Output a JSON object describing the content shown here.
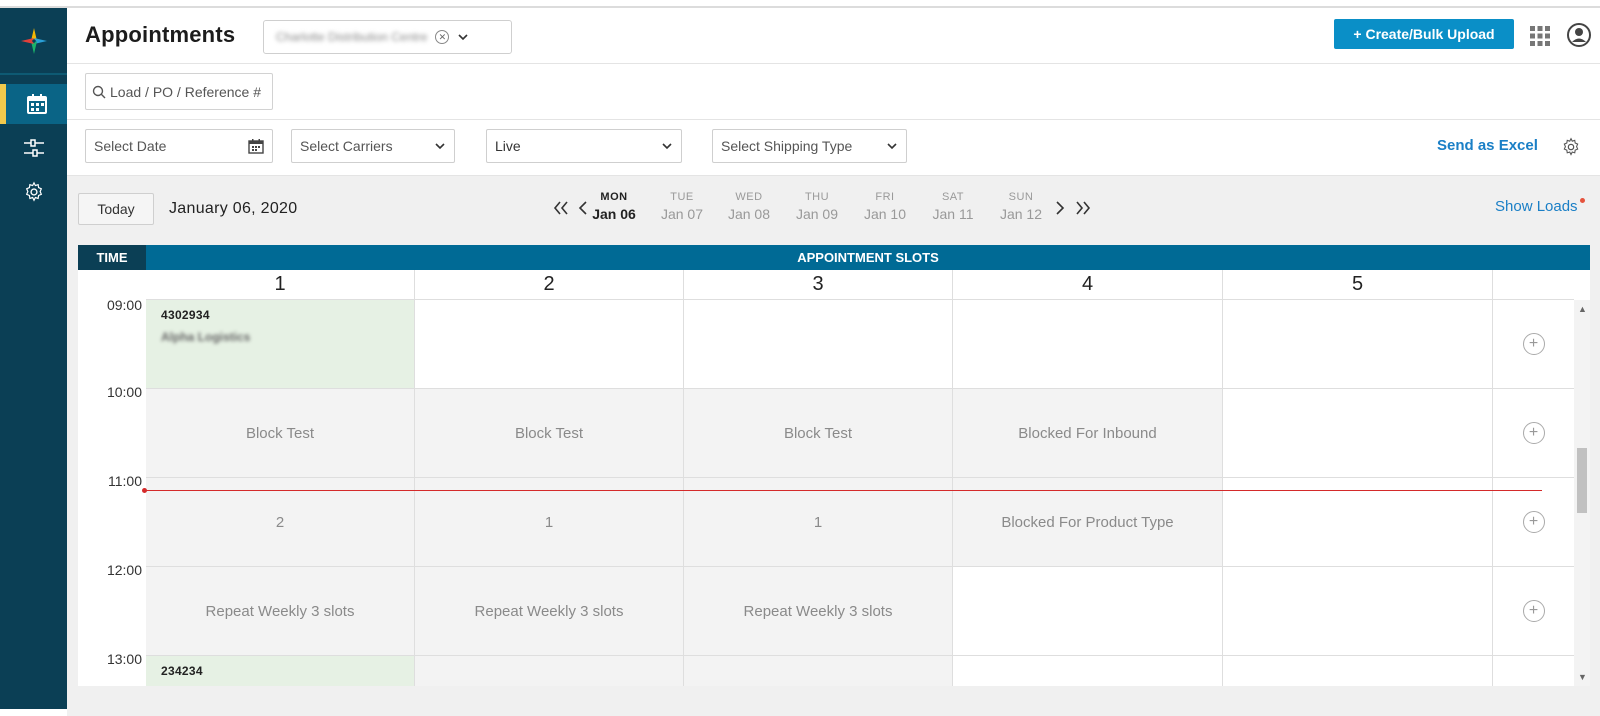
{
  "header": {
    "title": "Appointments",
    "facility_value": "Charlotte Distribution Centre",
    "create_label": "+ Create/Bulk Upload"
  },
  "search": {
    "placeholder": "Load / PO / Reference #"
  },
  "filters": {
    "date_placeholder": "Select Date",
    "carriers_placeholder": "Select Carriers",
    "status_value": "Live",
    "shipping_placeholder": "Select Shipping Type",
    "excel_label": "Send as Excel"
  },
  "calendar": {
    "today_label": "Today",
    "current_date": "January 06, 2020",
    "show_loads_label": "Show Loads",
    "days": [
      {
        "dow": "MON",
        "date": "Jan 06"
      },
      {
        "dow": "TUE",
        "date": "Jan 07"
      },
      {
        "dow": "WED",
        "date": "Jan 08"
      },
      {
        "dow": "THU",
        "date": "Jan 09"
      },
      {
        "dow": "FRI",
        "date": "Jan 10"
      },
      {
        "dow": "SAT",
        "date": "Jan 11"
      },
      {
        "dow": "SUN",
        "date": "Jan 12"
      }
    ]
  },
  "grid": {
    "time_header": "TIME",
    "slots_header": "APPOINTMENT SLOTS",
    "columns": [
      "1",
      "2",
      "3",
      "4",
      "5"
    ],
    "times": [
      "09:00",
      "10:00",
      "11:00",
      "12:00",
      "13:00"
    ],
    "rows": [
      {
        "cells": [
          {
            "type": "booked",
            "ref": "4302934",
            "carrier": "Alpha Logistics"
          },
          {
            "type": "empty",
            "text": ""
          },
          {
            "type": "empty",
            "text": ""
          },
          {
            "type": "empty",
            "text": ""
          },
          {
            "type": "empty",
            "text": ""
          }
        ]
      },
      {
        "cells": [
          {
            "type": "block",
            "text": "Block Test"
          },
          {
            "type": "block",
            "text": "Block Test"
          },
          {
            "type": "block",
            "text": "Block Test"
          },
          {
            "type": "block",
            "text": "Blocked For Inbound"
          },
          {
            "type": "empty",
            "text": ""
          }
        ]
      },
      {
        "cells": [
          {
            "type": "block",
            "text": "2"
          },
          {
            "type": "block",
            "text": "1"
          },
          {
            "type": "block",
            "text": "1"
          },
          {
            "type": "block",
            "text": "Blocked For Product Type"
          },
          {
            "type": "empty",
            "text": ""
          }
        ]
      },
      {
        "cells": [
          {
            "type": "block",
            "text": "Repeat Weekly 3 slots"
          },
          {
            "type": "block",
            "text": "Repeat Weekly 3 slots"
          },
          {
            "type": "block",
            "text": "Repeat Weekly 3 slots"
          },
          {
            "type": "empty",
            "text": ""
          },
          {
            "type": "empty",
            "text": ""
          }
        ]
      },
      {
        "cells": [
          {
            "type": "booked",
            "ref": "234234",
            "carrier": ""
          },
          {
            "type": "block",
            "text": ""
          },
          {
            "type": "block",
            "text": ""
          },
          {
            "type": "empty",
            "text": ""
          },
          {
            "type": "empty",
            "text": ""
          }
        ]
      }
    ]
  },
  "colors": {
    "sidebar": "#0b3f55",
    "accent": "#0a8fc7",
    "slots_header": "#006a95",
    "booked": "#e6f1e4",
    "now_line": "#d42a2a"
  }
}
